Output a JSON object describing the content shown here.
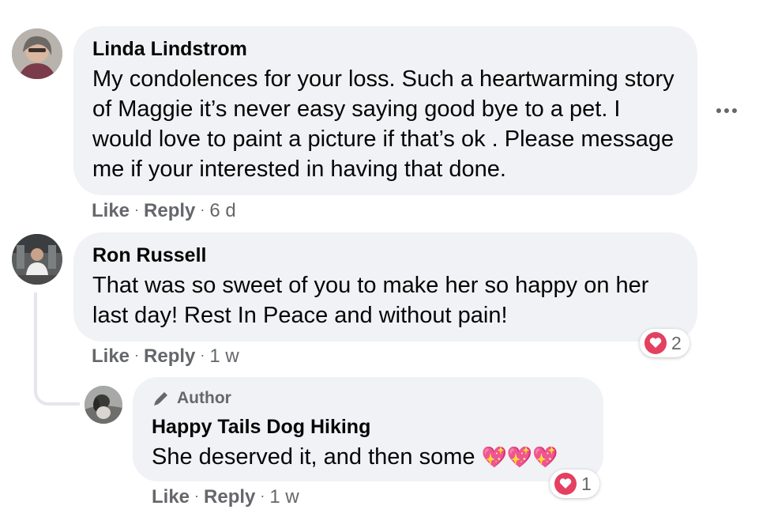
{
  "comments": [
    {
      "author": "Linda Lindstrom",
      "text": "My condolences for your loss. Such a heartwarming story of Maggie it’s never easy saying good bye to a pet. I would love to paint a picture if that’s ok . Please message me if your interested in having that done.",
      "like": "Like",
      "reply": "Reply",
      "time": "6 d"
    },
    {
      "author": "Ron Russell",
      "text": "That was so sweet of you to make her so happy on her last day! Rest In Peace and without pain!",
      "like": "Like",
      "reply": "Reply",
      "time": "1 w",
      "reaction_count": "2"
    }
  ],
  "reply": {
    "badge": "Author",
    "author": "Happy Tails Dog Hiking",
    "text": "She deserved it, and then some",
    "emoji": "💖💖💖",
    "like": "Like",
    "reply": "Reply",
    "time": "1 w",
    "reaction_count": "1"
  },
  "icons": {
    "more": "more-options-icon",
    "reaction": "love-reaction-icon",
    "author_badge": "pencil-icon"
  },
  "colors": {
    "bubble": "#f0f2f5",
    "meta": "#65676b",
    "love": "#e4405f"
  }
}
